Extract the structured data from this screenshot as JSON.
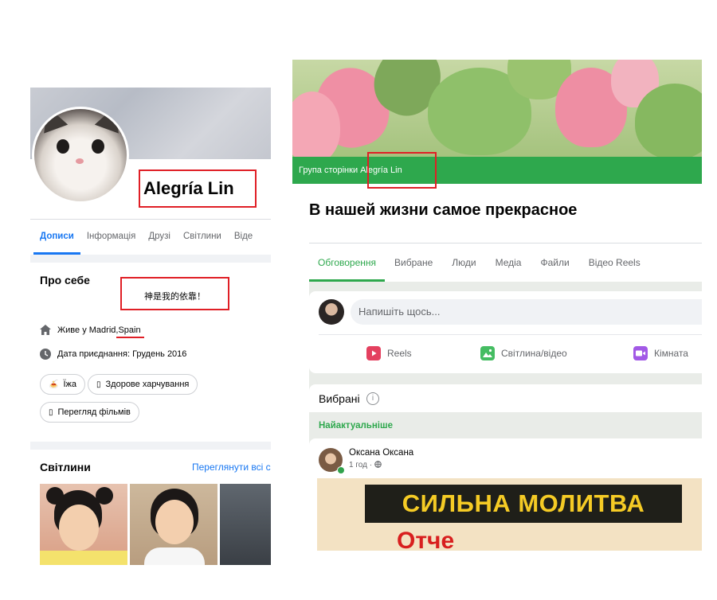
{
  "left_profile": {
    "name": "Alegría Lin",
    "tabs": [
      {
        "label": "Дописи",
        "active": true
      },
      {
        "label": "Інформація"
      },
      {
        "label": "Друзі"
      },
      {
        "label": "Світлини"
      },
      {
        "label": "Віде"
      }
    ],
    "about": {
      "title": "Про себе",
      "bio": "神是我的依靠！",
      "lives_prefix": "Живе у Madrid, ",
      "lives_country": "Spain",
      "joined": "Дата приєднання: Грудень 2016",
      "interests": [
        {
          "icon": "🍝",
          "label": "Їжа"
        },
        {
          "icon": "▯",
          "label": "Здорове харчування"
        },
        {
          "icon": "▯",
          "label": "Перегляд фільмів"
        }
      ]
    },
    "photos": {
      "title": "Світлини",
      "see_all": "Переглянути всі с"
    }
  },
  "right_group": {
    "group_prefix": "Група сторінки",
    "group_owner": "Alegría Lin",
    "title": "В нашей жизни самое прекрасное",
    "tabs": [
      {
        "label": "Обговорення",
        "active": true
      },
      {
        "label": "Вибране"
      },
      {
        "label": "Люди"
      },
      {
        "label": "Медіа"
      },
      {
        "label": "Файли"
      },
      {
        "label": "Відео Reels"
      }
    ],
    "composer": {
      "placeholder": "Напишіть щось...",
      "actions": [
        {
          "label": "Reels",
          "icon": "reels-icon",
          "color": "#e4405f"
        },
        {
          "label": "Світлина/відео",
          "icon": "photo-icon",
          "color": "#45bd62"
        },
        {
          "label": "Кімната",
          "icon": "room-icon",
          "color": "#a259e6"
        }
      ]
    },
    "featured": {
      "label": "Вибрані",
      "info_glyph": "i"
    },
    "sort_label": "Найактуальніше",
    "post": {
      "author": "Оксана Оксана",
      "meta": "1 год · ",
      "image_line1": "СИЛЬНА МОЛИТВА",
      "image_line2": "Отче"
    }
  },
  "colors": {
    "fb_blue": "#1877f2",
    "group_green": "#2ea84d",
    "annotation_red": "#e01f26"
  }
}
